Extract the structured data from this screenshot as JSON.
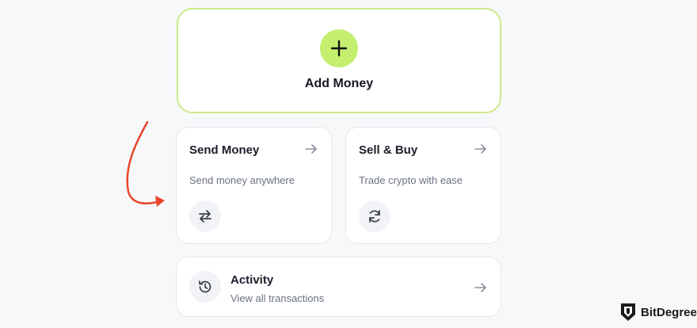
{
  "add_money": {
    "label": "Add Money",
    "icon": "plus-icon"
  },
  "send_money": {
    "title": "Send Money",
    "subtitle": "Send money anywhere",
    "icon": "transfer-arrows-icon"
  },
  "sell_buy": {
    "title": "Sell & Buy",
    "subtitle": "Trade crypto with ease",
    "icon": "refresh-icon"
  },
  "activity": {
    "title": "Activity",
    "subtitle": "View all transactions",
    "icon": "history-icon"
  },
  "annotation": {
    "color": "#e8462b",
    "icon": "curved-arrow-icon"
  },
  "brand": {
    "name": "BitDegree",
    "icon": "bitdegree-shield-logo"
  },
  "colors": {
    "accent": "#c4ef6e",
    "accent_border": "#cde98a"
  }
}
